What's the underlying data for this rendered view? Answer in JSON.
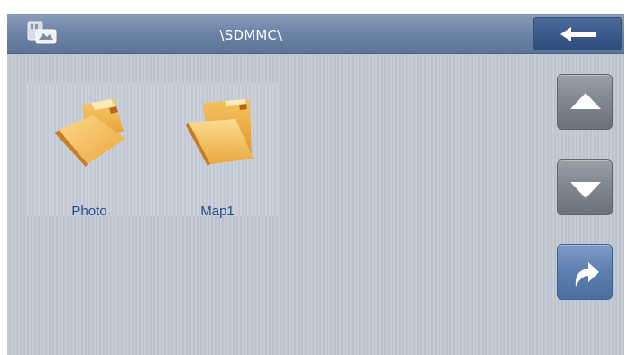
{
  "header": {
    "path": "\\SDMMC\\",
    "app_icon": "device-card-icon",
    "back_icon": "arrow-left-icon"
  },
  "files": [
    {
      "name": "Photo",
      "icon": "folder-icon"
    },
    {
      "name": "Map1",
      "icon": "folder-open-icon"
    }
  ],
  "sidebar": {
    "up_icon": "triangle-up-icon",
    "down_icon": "triangle-down-icon",
    "open_icon": "curved-arrow-right-icon"
  },
  "colors": {
    "titlebar": "#6e84a7",
    "background": "#c6ccd6",
    "file_label": "#2a4a86",
    "folder": "#f0b44c",
    "button_blue": "#5d7fb0",
    "button_gray": "#7f8690"
  }
}
